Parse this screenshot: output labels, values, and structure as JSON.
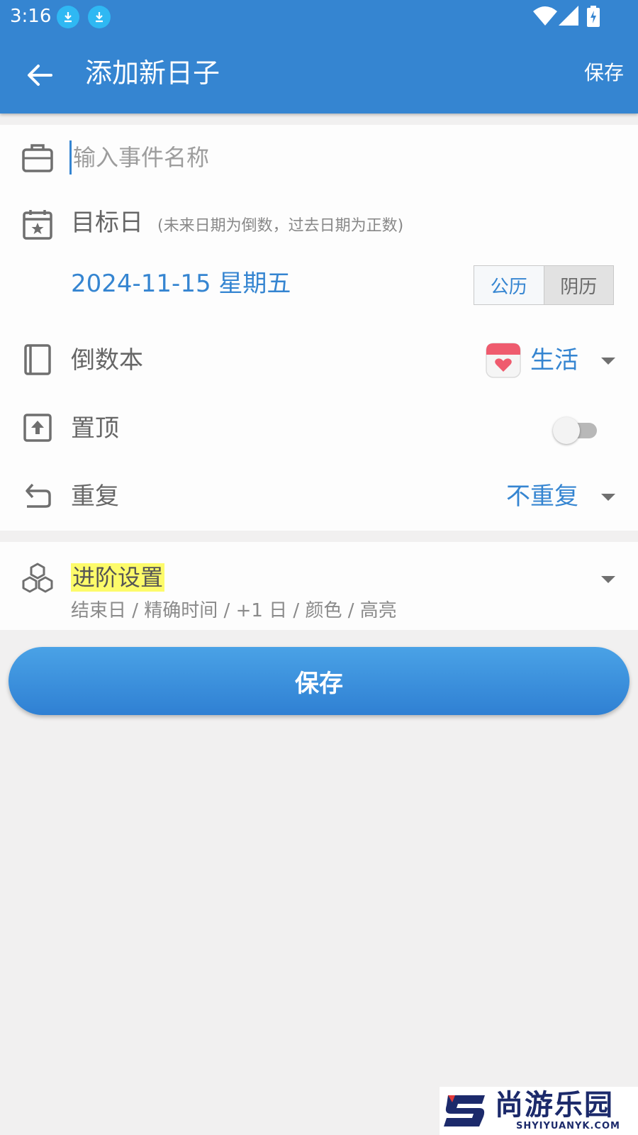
{
  "status_bar": {
    "time": "3:16"
  },
  "toolbar": {
    "title": "添加新日子",
    "save_label": "保存"
  },
  "form": {
    "name_placeholder": "输入事件名称",
    "target_date_label": "目标日",
    "target_date_hint": "(未来日期为倒数，过去日期为正数)",
    "date_value": "2024-11-15 星期五",
    "calendar_options": [
      "公历",
      "阴历"
    ],
    "calendar_selected": "公历",
    "book_label": "倒数本",
    "book_value": "生活",
    "pin_label": "置顶",
    "pin_enabled": false,
    "repeat_label": "重复",
    "repeat_value": "不重复"
  },
  "advanced": {
    "label": "进阶设置",
    "subtitle": "结束日 / 精确时间 / +1 日 / 颜色 / 高亮"
  },
  "save_button": {
    "label": "保存"
  },
  "watermark": {
    "text": "尚游乐园",
    "sub": "SHYIYUANYK.COM"
  },
  "colors": {
    "primary": "#3585d1",
    "highlight": "#fdfb6a",
    "background": "#f1f0f0"
  }
}
